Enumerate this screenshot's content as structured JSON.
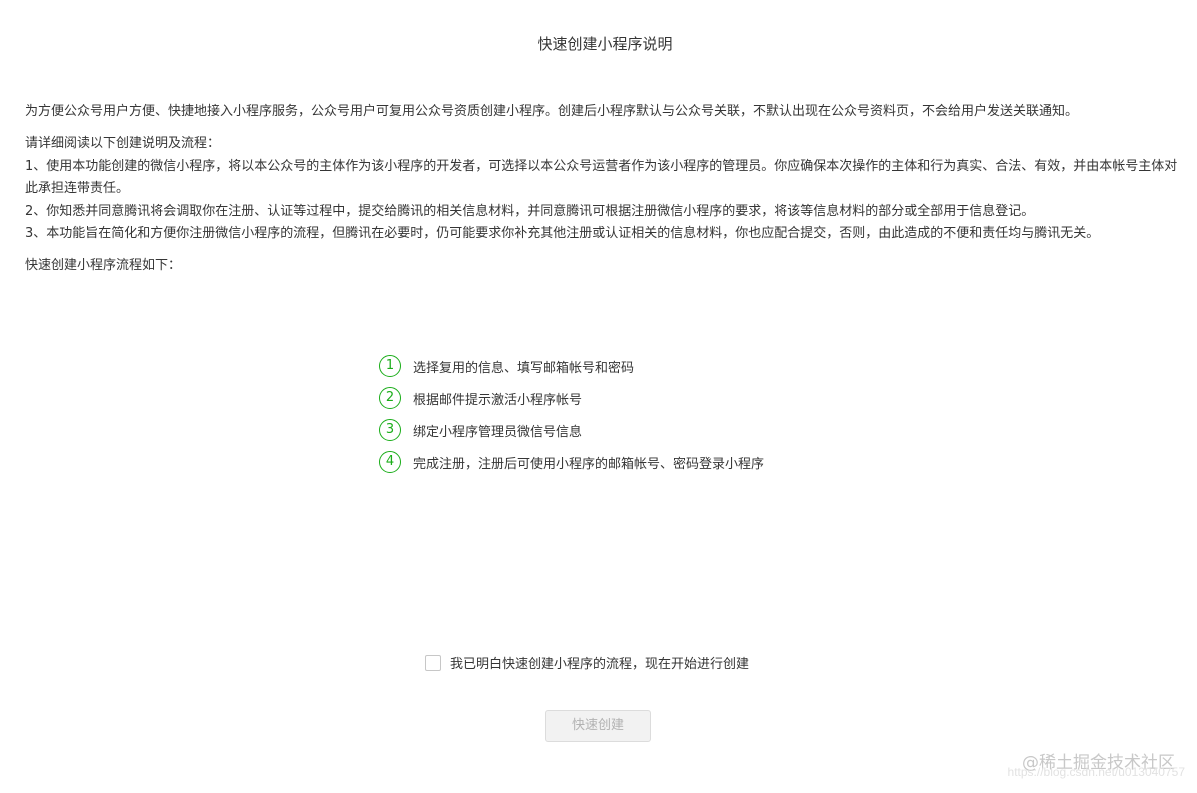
{
  "header": {
    "title": "快速创建小程序说明"
  },
  "intro": {
    "text": "为方便公众号用户方便、快捷地接入小程序服务，公众号用户可复用公众号资质创建小程序。创建后小程序默认与公众号关联，不默认出现在公众号资料页，不会给用户发送关联通知。"
  },
  "instructions": {
    "heading": "请详细阅读以下创建说明及流程：",
    "items": [
      "1、使用本功能创建的微信小程序，将以本公众号的主体作为该小程序的开发者，可选择以本公众号运营者作为该小程序的管理员。你应确保本次操作的主体和行为真实、合法、有效，并由本帐号主体对此承担连带责任。",
      "2、你知悉并同意腾讯将会调取你在注册、认证等过程中，提交给腾讯的相关信息材料，并同意腾讯可根据注册微信小程序的要求，将该等信息材料的部分或全部用于信息登记。",
      "3、本功能旨在简化和方便你注册微信小程序的流程，但腾讯在必要时，仍可能要求你补充其他注册或认证相关的信息材料，你也应配合提交，否则，由此造成的不便和责任均与腾讯无关。"
    ]
  },
  "flow": {
    "heading": "快速创建小程序流程如下：",
    "steps": [
      {
        "num": "1",
        "text": "选择复用的信息、填写邮箱帐号和密码"
      },
      {
        "num": "2",
        "text": "根据邮件提示激活小程序帐号"
      },
      {
        "num": "3",
        "text": "绑定小程序管理员微信号信息"
      },
      {
        "num": "4",
        "text": "完成注册，注册后可使用小程序的邮箱帐号、密码登录小程序"
      }
    ]
  },
  "agreement": {
    "label": "我已明白快速创建小程序的流程，现在开始进行创建",
    "checked": false
  },
  "actions": {
    "create_label": "快速创建",
    "create_enabled": false
  },
  "watermark": {
    "brand": "@稀土掘金技术社区",
    "url": "https://blog.csdn.net/u013040757"
  },
  "colors": {
    "accent": "#1aad19",
    "text": "#353535",
    "disabled_text": "#b2b2b2"
  }
}
